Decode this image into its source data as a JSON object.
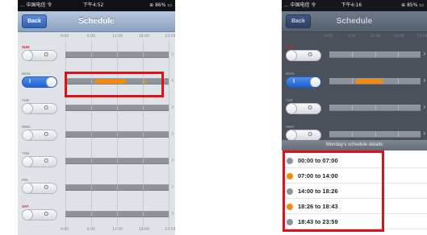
{
  "left_screen": {
    "status_bar": {
      "carrier": "... 中国电信 令",
      "time": "下午4:52",
      "battery": "⊕ 86% ▭"
    },
    "nav": {
      "back_label": "Back",
      "title": "Schedule"
    },
    "time_labels": [
      "0:00",
      "6:00",
      "12:00",
      "18:00",
      "23:59"
    ],
    "days": [
      {
        "label": "SUN",
        "weekend": true,
        "enabled": false,
        "toggle_text": "O",
        "segments": []
      },
      {
        "label": "MON",
        "weekend": false,
        "enabled": true,
        "toggle_text": "I",
        "segments": [
          {
            "start": 7.0,
            "end": 14.0
          },
          {
            "start": 18.43,
            "end": 18.72
          }
        ]
      },
      {
        "label": "TUE",
        "weekend": false,
        "enabled": false,
        "toggle_text": "O",
        "segments": []
      },
      {
        "label": "WED",
        "weekend": false,
        "enabled": false,
        "toggle_text": "O",
        "segments": []
      },
      {
        "label": "THU",
        "weekend": false,
        "enabled": false,
        "toggle_text": "O",
        "segments": []
      },
      {
        "label": "FRI",
        "weekend": false,
        "enabled": false,
        "toggle_text": "O",
        "segments": []
      },
      {
        "label": "SAT",
        "weekend": true,
        "enabled": false,
        "toggle_text": "O",
        "segments": []
      }
    ]
  },
  "right_screen": {
    "status_bar": {
      "carrier": "... 中国电信 令",
      "time": "下午4:16",
      "battery": "⊕ 85% ▭"
    },
    "nav": {
      "back_label": "Back",
      "title": "Schedule"
    },
    "time_labels": [
      "0:00",
      "6:00",
      "12:00",
      "18:00",
      "23:59"
    ],
    "visible_days": [
      {
        "label": "SUN",
        "weekend": true,
        "enabled": false,
        "toggle_text": "O"
      },
      {
        "label": "MON",
        "weekend": false,
        "enabled": true,
        "toggle_text": "I",
        "segments": [
          {
            "start": 7.0,
            "end": 14.0
          }
        ]
      },
      {
        "label": "TUE",
        "weekend": false,
        "enabled": false,
        "toggle_text": "O"
      },
      {
        "label": "WED",
        "weekend": false,
        "enabled": false,
        "toggle_text": "O"
      }
    ],
    "details_title": "Monday's schedule details",
    "details": [
      {
        "text": "00:00 to 07:00",
        "color": "#8f9399"
      },
      {
        "text": "07:00 to 14:00",
        "color": "#f18a12"
      },
      {
        "text": "14:00 to 18:26",
        "color": "#8f9399"
      },
      {
        "text": "18:26 to 18:43",
        "color": "#f18a12"
      },
      {
        "text": "18:43 to 23:59",
        "color": "#8f9399"
      }
    ]
  },
  "colors": {
    "on": "#f18a12",
    "off": "#8f9399",
    "highlight": "#e01018"
  }
}
